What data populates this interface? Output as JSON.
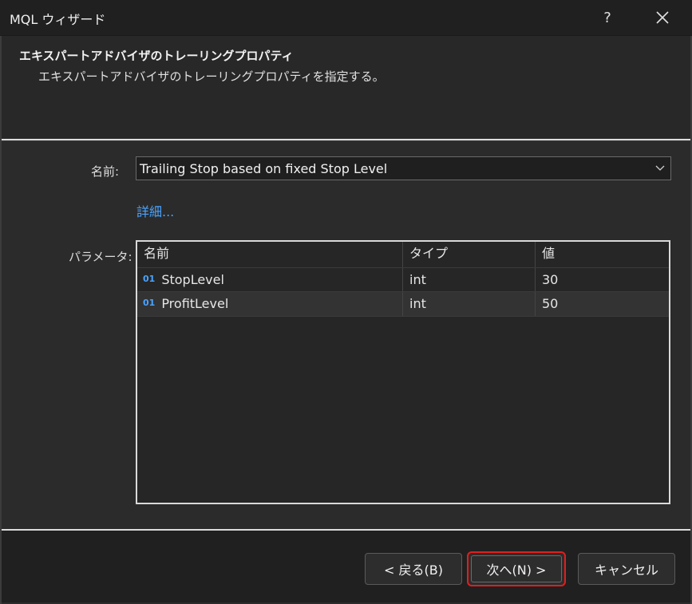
{
  "window": {
    "title": "MQL ウィザード",
    "help_label": "?",
    "close_label": "✕"
  },
  "header": {
    "title": "エキスパートアドバイザのトレーリングプロパティ",
    "subtitle": "エキスパートアドバイザのトレーリングプロパティを指定する。"
  },
  "form": {
    "name_label": "名前:",
    "name_value": "Trailing Stop based on fixed Stop Level",
    "details_link": "詳細...",
    "params_label": "パラメータ:"
  },
  "params_table": {
    "columns": [
      "名前",
      "タイプ",
      "値"
    ],
    "rows": [
      {
        "icon": "01",
        "name": "StopLevel",
        "type": "int",
        "value": "30"
      },
      {
        "icon": "01",
        "name": "ProfitLevel",
        "type": "int",
        "value": "50"
      }
    ]
  },
  "buttons": {
    "back": "< 戻る(B)",
    "next": "次へ(N) >",
    "cancel": "キャンセル"
  },
  "colors": {
    "accent_link": "#4aa3ff",
    "highlight_border": "#e01e1e",
    "background": "#2b2b2b"
  },
  "icons": {
    "dropdown": "chevron-down-icon",
    "param": "integer-param-icon"
  }
}
